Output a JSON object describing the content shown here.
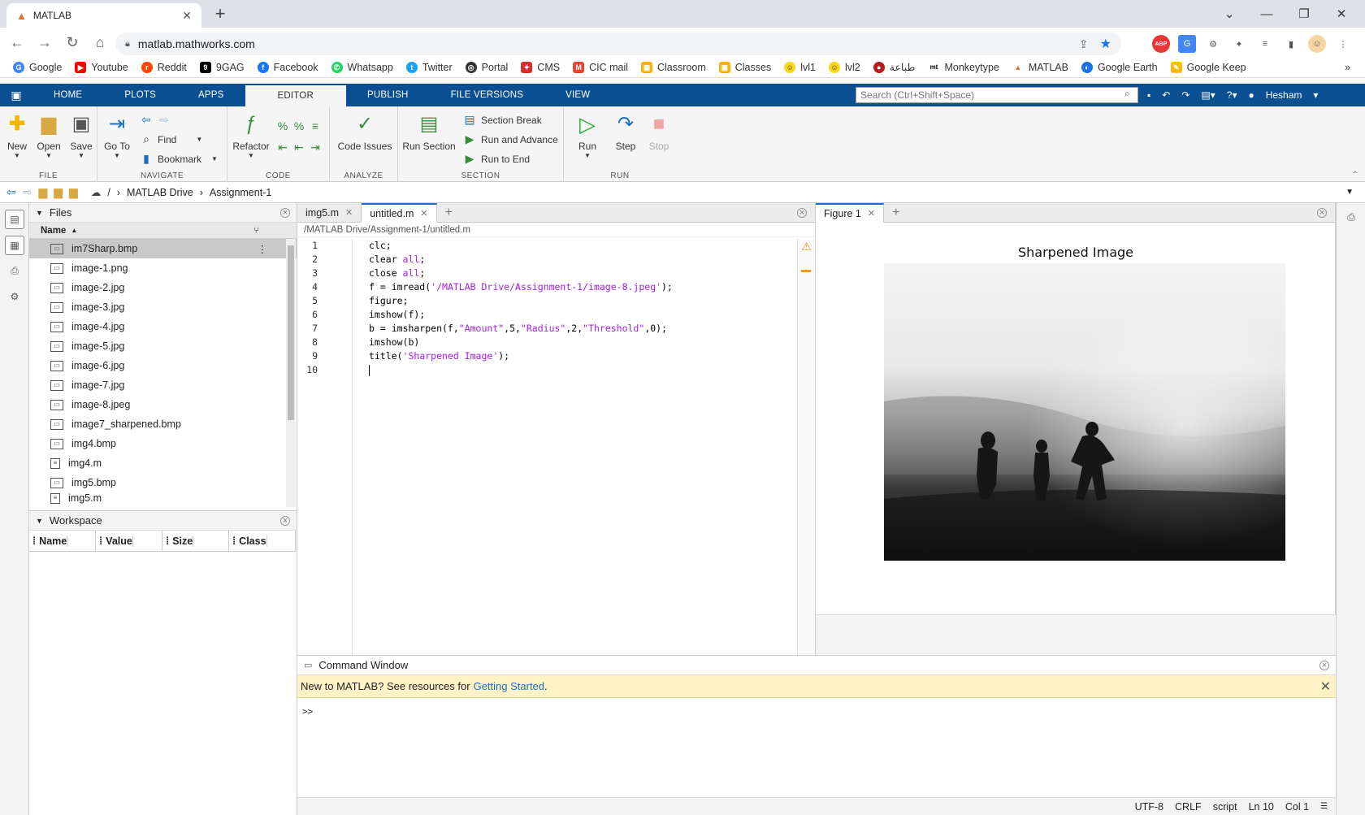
{
  "browser": {
    "tab_title": "MATLAB",
    "url": "matlab.mathworks.com",
    "bookmarks": [
      "Google",
      "Youtube",
      "Reddit",
      "9GAG",
      "Facebook",
      "Whatsapp",
      "Twitter",
      "Portal",
      "CMS",
      "CIC mail",
      "Classroom",
      "Classes",
      "lvl1",
      "lvl2",
      "طباعة",
      "Monkeytype",
      "MATLAB",
      "Google Earth",
      "Google Keep"
    ],
    "extensions": [
      "ABP"
    ]
  },
  "matlab": {
    "tabs": [
      "HOME",
      "PLOTS",
      "APPS",
      "EDITOR",
      "PUBLISH",
      "FILE VERSIONS",
      "VIEW"
    ],
    "active_tab": "EDITOR",
    "search_placeholder": "Search (Ctrl+Shift+Space)",
    "user": "Hesham",
    "ribbon": {
      "file": {
        "label": "FILE",
        "new": "New",
        "open": "Open",
        "save": "Save"
      },
      "navigate": {
        "label": "NAVIGATE",
        "goto": "Go To",
        "find": "Find",
        "bookmark": "Bookmark"
      },
      "code": {
        "label": "CODE",
        "refactor": "Refactor"
      },
      "analyze": {
        "label": "ANALYZE",
        "code_issues": "Code Issues"
      },
      "section": {
        "label": "SECTION",
        "run_section": "Run Section",
        "section_break": "Section Break",
        "run_and_advance": "Run and Advance",
        "run_to_end": "Run to End"
      },
      "run": {
        "label": "RUN",
        "run": "Run",
        "step": "Step",
        "stop": "Stop"
      }
    },
    "path": {
      "root": "/",
      "drive": "MATLAB Drive",
      "folder": "Assignment-1"
    },
    "files": {
      "title": "Files",
      "column": "Name",
      "items": [
        "im7Sharp.bmp",
        "image-1.png",
        "image-2.jpg",
        "image-3.jpg",
        "image-4.jpg",
        "image-5.jpg",
        "image-6.jpg",
        "image-7.jpg",
        "image-8.jpeg",
        "image7_sharpened.bmp",
        "img4.bmp",
        "img4.m",
        "img5.bmp",
        "img5.m"
      ]
    },
    "workspace": {
      "title": "Workspace",
      "columns": [
        "Name",
        "Value",
        "Size",
        "Class"
      ]
    },
    "editor": {
      "tabs": [
        "img5.m",
        "untitled.m"
      ],
      "active": "untitled.m",
      "path": "/MATLAB Drive/Assignment-1/untitled.m",
      "line_numbers": [
        "1",
        "2",
        "3",
        "4",
        "5",
        "6",
        "7",
        "8",
        "9",
        "10"
      ]
    },
    "figure": {
      "tab": "Figure 1",
      "title": "Sharpened Image"
    },
    "command_window": {
      "title": "Command Window",
      "banner_text": "New to MATLAB? See resources for",
      "banner_link": "Getting Started",
      "banner_end": ".",
      "prompt": ">>"
    },
    "status": {
      "encoding": "UTF-8",
      "eol": "CRLF",
      "type": "script",
      "ln": "Ln  10",
      "col": "Col  1"
    }
  }
}
